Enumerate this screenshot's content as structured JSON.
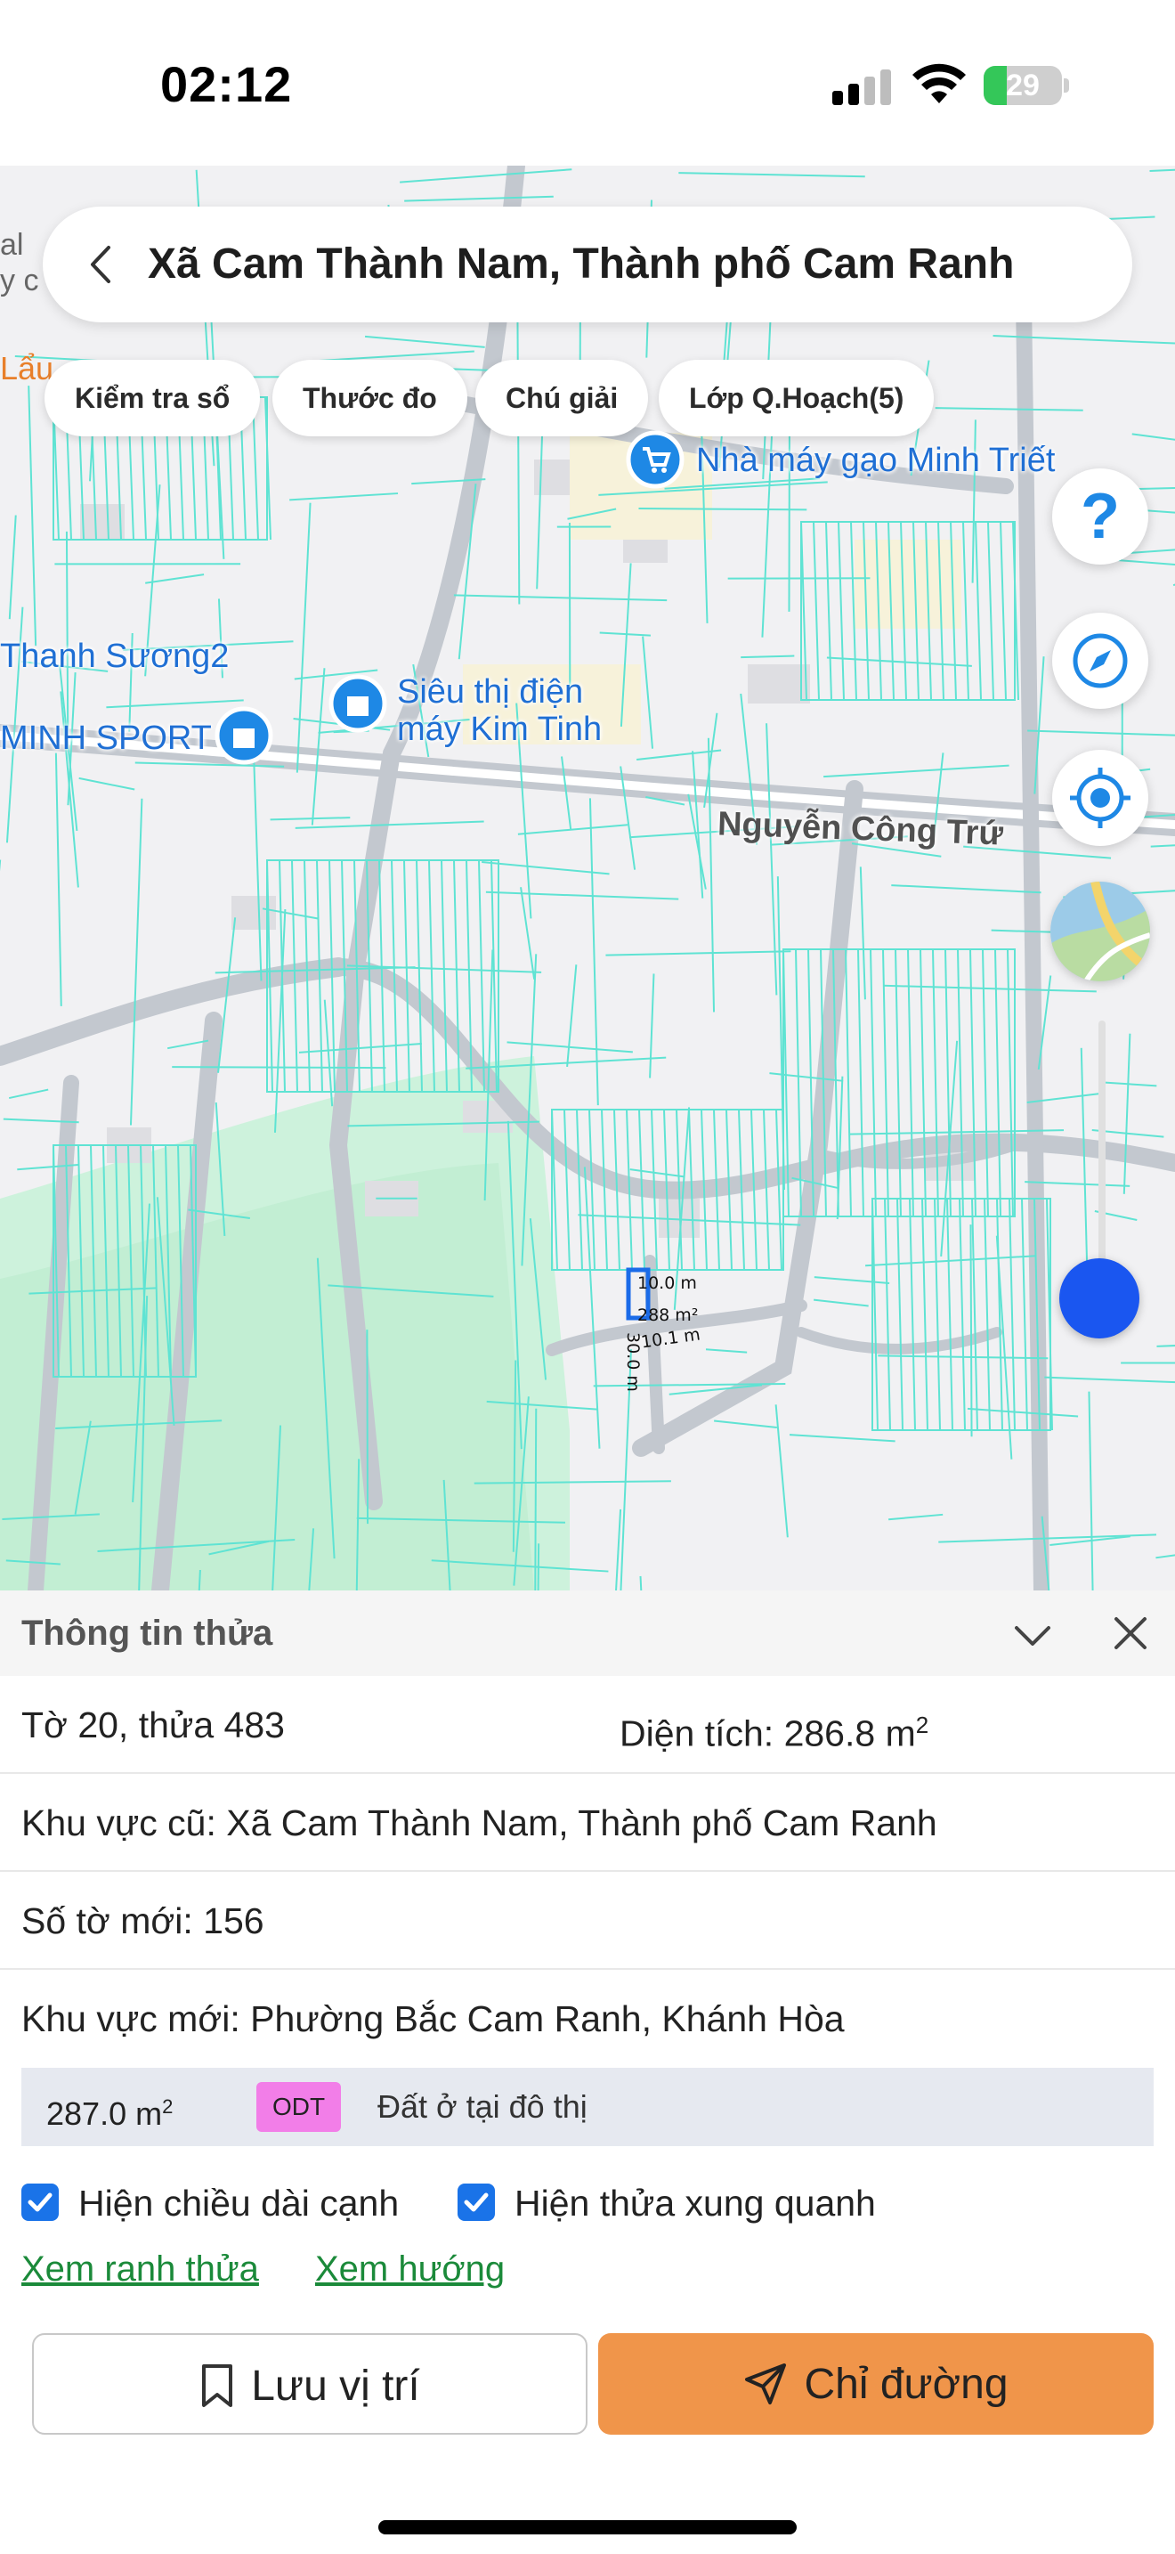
{
  "status_bar": {
    "time": "02:12",
    "battery_level": 29,
    "battery_label": "29"
  },
  "map": {
    "location_title": "Xã Cam Thành Nam, Thành phố Cam Ranh",
    "chips": [
      "Kiểm tra sổ",
      "Thước đo",
      "Chú giải",
      "Lớp Q.Hoạch(5)"
    ],
    "pois": {
      "rice_mill": "Nhà máy gạo Minh Triết",
      "electronics_line1": "Siêu thị điện",
      "electronics_line2": "máy Kim Tinh",
      "sport": "MINH SPORT",
      "thanh_suong": "Thanh Sương2"
    },
    "road_name": "Nguyễn Công Trứ",
    "parcel": {
      "top_edge": "10.0 m",
      "area": "288 m²",
      "bottom_edge": "10.1 m",
      "side_edge": "30.0 m"
    },
    "colors": {
      "parcel_lines": "#5fe3d3",
      "poi_blue": "#1e88e5",
      "selected_parcel": "#1a6be8",
      "park": "#c9f1d8"
    }
  },
  "sheet": {
    "title": "Thông tin thửa",
    "sheet_parcel": "Tờ 20, thửa 483",
    "area_label": "Diện tích: 286.8 m",
    "area_sup": "2",
    "old_area": "Khu vực cũ: Xã Cam Thành Nam, Thành phố Cam Ranh",
    "new_sheet": "Số tờ mới: 156",
    "new_area": "Khu vực mới: Phường Bắc Cam Ranh, Khánh Hòa",
    "usage": {
      "area": "287.0 m",
      "area_sup": "2",
      "code": "ODT",
      "name": "Đất ở tại đô thị",
      "code_color": "#f27ee8"
    },
    "checkboxes": [
      {
        "label": "Hiện chiều dài cạnh",
        "checked": true
      },
      {
        "label": "Hiện thửa xung quanh",
        "checked": true
      }
    ],
    "links": [
      "Xem ranh thửa",
      "Xem hướng"
    ],
    "save_label": "Lưu vị trí",
    "direction_label": "Chỉ đường",
    "accent_color": "#f0954a"
  }
}
